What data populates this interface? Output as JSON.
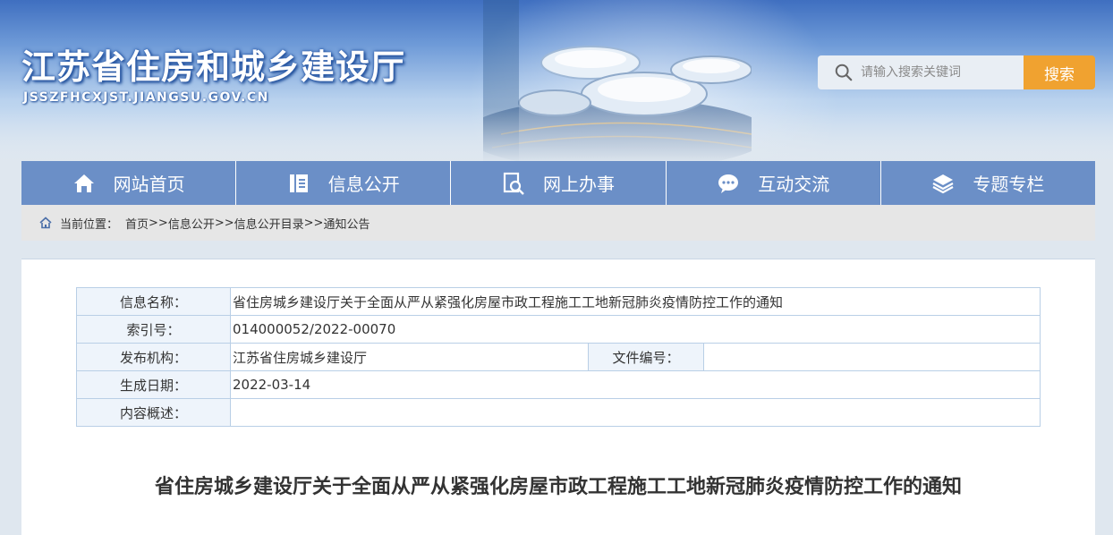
{
  "header": {
    "title": "江苏省住房和城乡建设厅",
    "domain": "JSSZFHCXJST.JIANGSU.GOV.CN",
    "search_placeholder": "请输入搜索关键词",
    "search_button": "搜索"
  },
  "nav": {
    "items": [
      {
        "label": "网站首页",
        "icon": "home-icon"
      },
      {
        "label": "信息公开",
        "icon": "document-icon"
      },
      {
        "label": "网上办事",
        "icon": "search-document-icon"
      },
      {
        "label": "互动交流",
        "icon": "chat-icon"
      },
      {
        "label": "专题专栏",
        "icon": "layers-icon"
      }
    ]
  },
  "breadcrumb": {
    "label": "当前位置：",
    "items": [
      "首页",
      "信息公开",
      "信息公开目录",
      "通知公告"
    ],
    "separator": ">>"
  },
  "meta": {
    "name_label": "信息名称：",
    "name_value": "省住房城乡建设厅关于全面从严从紧强化房屋市政工程施工工地新冠肺炎疫情防控工作的通知",
    "index_label": "索引号：",
    "index_value": "014000052/2022-00070",
    "publisher_label": "发布机构：",
    "publisher_value": "江苏省住房城乡建设厅",
    "docno_label": "文件编号：",
    "docno_value": "",
    "date_label": "生成日期：",
    "date_value": "2022-03-14",
    "summary_label": "内容概述：",
    "summary_value": ""
  },
  "article": {
    "title": "省住房城乡建设厅关于全面从严从紧强化房屋市政工程施工工地新冠肺炎疫情防控工作的通知"
  },
  "colors": {
    "nav_bg": "#6b8fc7",
    "search_button": "#f0a230",
    "table_border": "#b9cfe6"
  }
}
